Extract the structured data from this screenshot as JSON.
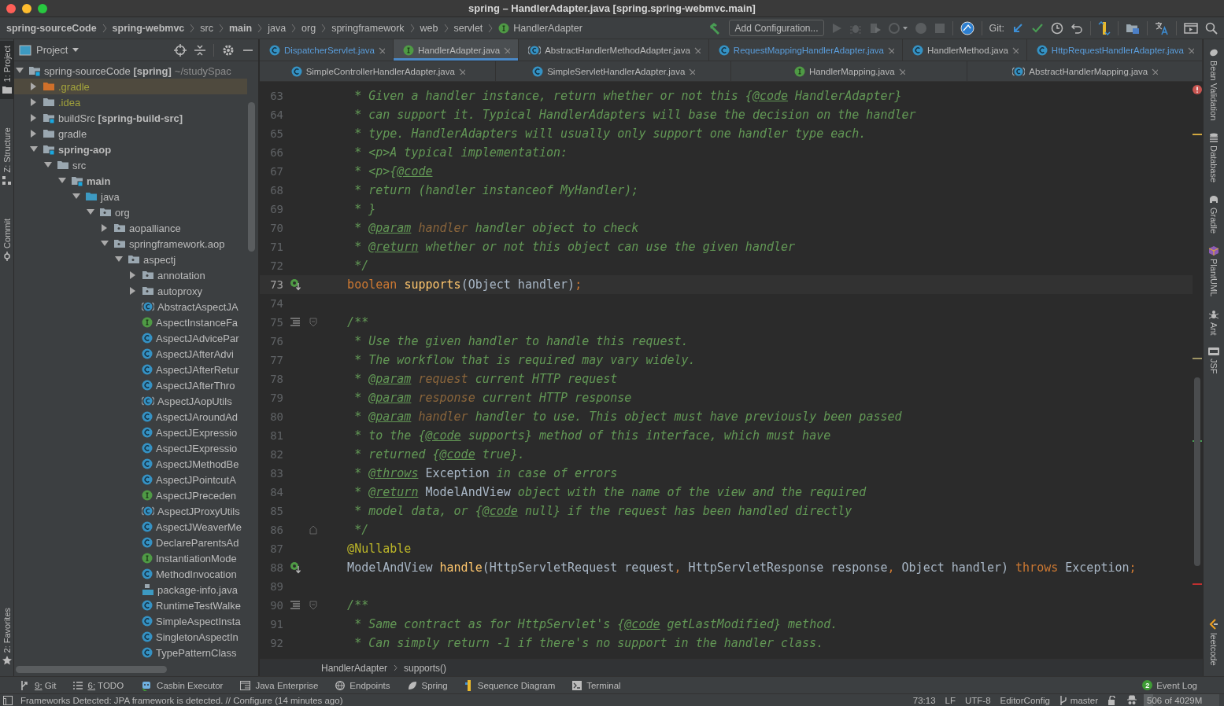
{
  "window": {
    "title": "spring – HandlerAdapter.java [spring.spring-webmvc.main]"
  },
  "navbar": {
    "breadcrumbs": [
      {
        "label": "spring-sourceCode",
        "bold": true
      },
      {
        "label": "spring-webmvc",
        "bold": true
      },
      {
        "label": "src"
      },
      {
        "label": "main",
        "bold": true
      },
      {
        "label": "java"
      },
      {
        "label": "org"
      },
      {
        "label": "springframework"
      },
      {
        "label": "web"
      },
      {
        "label": "servlet"
      },
      {
        "label": "HandlerAdapter",
        "kind": "interface"
      }
    ],
    "config_button": "Add Configuration...",
    "git_label": "Git:"
  },
  "left_tool_strip": {
    "top": [
      {
        "label": "1: Project",
        "selected": true
      },
      {
        "label": "Z: Structure",
        "selected": false
      },
      {
        "label": "Commit",
        "selected": false
      }
    ],
    "bottom": [
      {
        "label": "2: Favorites",
        "selected": false
      }
    ]
  },
  "project": {
    "title": "Project",
    "tree": [
      {
        "label": "spring-sourceCode **[spring]**",
        "suffix": "~/studySpac",
        "kind": "module",
        "expanded": true,
        "selected": false,
        "ignored": false,
        "children": [
          {
            "label": ".gradle",
            "kind": "excluded-folder",
            "expanded": false,
            "selected": true,
            "ignored": true
          },
          {
            "label": ".idea",
            "kind": "folder",
            "expanded": false,
            "selected": false,
            "ignored": true
          },
          {
            "label": "buildSrc **[spring-build-src]**",
            "kind": "module",
            "expanded": false,
            "selected": false,
            "ignored": false
          },
          {
            "label": "gradle",
            "kind": "folder",
            "expanded": false,
            "selected": false,
            "ignored": false
          },
          {
            "label": "spring-aop",
            "bold": true,
            "kind": "module",
            "expanded": true,
            "selected": false,
            "ignored": false,
            "children": [
              {
                "label": "src",
                "kind": "folder",
                "expanded": true,
                "selected": false,
                "ignored": false,
                "children": [
                  {
                    "label": "main",
                    "bold": true,
                    "kind": "module",
                    "expanded": true,
                    "selected": false,
                    "ignored": false,
                    "children": [
                      {
                        "label": "java",
                        "kind": "source-root",
                        "expanded": true,
                        "selected": false,
                        "ignored": false,
                        "children": [
                          {
                            "label": "org",
                            "kind": "package",
                            "expanded": true,
                            "selected": false,
                            "ignored": false,
                            "children": [
                              {
                                "label": "aopalliance",
                                "kind": "package",
                                "expanded": false,
                                "selected": false,
                                "ignored": false
                              },
                              {
                                "label": "springframework.aop",
                                "kind": "package",
                                "expanded": true,
                                "selected": false,
                                "ignored": false,
                                "children": [
                                  {
                                    "label": "aspectj",
                                    "kind": "package",
                                    "expanded": true,
                                    "selected": false,
                                    "ignored": false,
                                    "children": [
                                      {
                                        "label": "annotation",
                                        "kind": "package",
                                        "expanded": false,
                                        "selected": false,
                                        "ignored": false
                                      },
                                      {
                                        "label": "autoproxy",
                                        "kind": "package",
                                        "expanded": false,
                                        "selected": false,
                                        "ignored": false
                                      },
                                      {
                                        "label": "AbstractAspectJA",
                                        "kind": "abstract",
                                        "selected": false,
                                        "ignored": false
                                      },
                                      {
                                        "label": "AspectInstanceFa",
                                        "kind": "interface",
                                        "selected": false,
                                        "ignored": false
                                      },
                                      {
                                        "label": "AspectJAdvicePar",
                                        "kind": "class",
                                        "selected": false,
                                        "ignored": false
                                      },
                                      {
                                        "label": "AspectJAfterAdvi",
                                        "kind": "class",
                                        "selected": false,
                                        "ignored": false
                                      },
                                      {
                                        "label": "AspectJAfterRetur",
                                        "kind": "class",
                                        "selected": false,
                                        "ignored": false
                                      },
                                      {
                                        "label": "AspectJAfterThro",
                                        "kind": "class",
                                        "selected": false,
                                        "ignored": false
                                      },
                                      {
                                        "label": "AspectJAopUtils",
                                        "kind": "abstract",
                                        "selected": false,
                                        "ignored": false
                                      },
                                      {
                                        "label": "AspectJAroundAd",
                                        "kind": "class",
                                        "selected": false,
                                        "ignored": false
                                      },
                                      {
                                        "label": "AspectJExpressio",
                                        "kind": "class",
                                        "selected": false,
                                        "ignored": false
                                      },
                                      {
                                        "label": "AspectJExpressio",
                                        "kind": "class",
                                        "selected": false,
                                        "ignored": false
                                      },
                                      {
                                        "label": "AspectJMethodBe",
                                        "kind": "class",
                                        "selected": false,
                                        "ignored": false
                                      },
                                      {
                                        "label": "AspectJPointcutA",
                                        "kind": "class",
                                        "selected": false,
                                        "ignored": false
                                      },
                                      {
                                        "label": "AspectJPreceden",
                                        "kind": "interface",
                                        "selected": false,
                                        "ignored": false
                                      },
                                      {
                                        "label": "AspectJProxyUtils",
                                        "kind": "abstract",
                                        "selected": false,
                                        "ignored": false
                                      },
                                      {
                                        "label": "AspectJWeaverMe",
                                        "kind": "class",
                                        "selected": false,
                                        "ignored": false
                                      },
                                      {
                                        "label": "DeclareParentsAd",
                                        "kind": "class",
                                        "selected": false,
                                        "ignored": false
                                      },
                                      {
                                        "label": "InstantiationMode",
                                        "kind": "interface",
                                        "selected": false,
                                        "ignored": false
                                      },
                                      {
                                        "label": "MethodInvocation",
                                        "kind": "class",
                                        "selected": false,
                                        "ignored": false
                                      },
                                      {
                                        "label": "package-info.java",
                                        "kind": "java-file",
                                        "selected": false,
                                        "ignored": false
                                      },
                                      {
                                        "label": "RuntimeTestWalke",
                                        "kind": "class",
                                        "selected": false,
                                        "ignored": false
                                      },
                                      {
                                        "label": "SimpleAspectInsta",
                                        "kind": "class",
                                        "selected": false,
                                        "ignored": false
                                      },
                                      {
                                        "label": "SingletonAspectIn",
                                        "kind": "class",
                                        "selected": false,
                                        "ignored": false
                                      },
                                      {
                                        "label": "TypePatternClass",
                                        "kind": "class",
                                        "selected": false,
                                        "ignored": false
                                      }
                                    ]
                                  }
                                ]
                              }
                            ]
                          }
                        ]
                      }
                    ]
                  }
                ]
              }
            ]
          }
        ]
      }
    ]
  },
  "editor_tabs": [
    {
      "tabs": [
        {
          "label": "DispatcherServlet.java",
          "kind": "class",
          "modified": true,
          "selected": false
        },
        {
          "label": "HandlerAdapter.java",
          "kind": "interface",
          "modified": false,
          "selected": true
        },
        {
          "label": "AbstractHandlerMethodAdapter.java",
          "kind": "abstract",
          "modified": false,
          "selected": false
        },
        {
          "label": "RequestMappingHandlerAdapter.java",
          "kind": "class",
          "modified": true,
          "selected": false
        },
        {
          "label": "HandlerMethod.java",
          "kind": "class",
          "modified": false,
          "selected": false
        },
        {
          "label": "HttpRequestHandlerAdapter.java",
          "kind": "class",
          "modified": true,
          "selected": false
        }
      ]
    },
    {
      "tabs": [
        {
          "label": "SimpleControllerHandlerAdapter.java",
          "kind": "class",
          "modified": false,
          "selected": false
        },
        {
          "label": "SimpleServletHandlerAdapter.java",
          "kind": "class",
          "modified": false,
          "selected": false
        },
        {
          "label": "HandlerMapping.java",
          "kind": "interface",
          "modified": false,
          "selected": false
        },
        {
          "label": "AbstractHandlerMapping.java",
          "kind": "abstract",
          "modified": false,
          "selected": false
        }
      ]
    }
  ],
  "code": {
    "lines": [
      {
        "number": "63",
        "current": false,
        "spans": [
          {
            "kind": "comment",
            "text": "     * Given a handler instance, return whether or not this {"
          },
          {
            "kind": "tag",
            "text": "@code"
          },
          {
            "kind": "comment",
            "text": " HandlerAdapter}"
          }
        ]
      },
      {
        "number": "64",
        "current": false,
        "spans": [
          {
            "kind": "comment",
            "text": "     * can support it. Typical HandlerAdapters will base the decision on the handler"
          }
        ]
      },
      {
        "number": "65",
        "current": false,
        "spans": [
          {
            "kind": "comment",
            "text": "     * type. HandlerAdapters will usually only support one handler type each."
          }
        ]
      },
      {
        "number": "66",
        "current": false,
        "spans": [
          {
            "kind": "comment",
            "text": "     * <p>A typical implementation:"
          }
        ]
      },
      {
        "number": "67",
        "current": false,
        "spans": [
          {
            "kind": "comment",
            "text": "     * <p>{"
          },
          {
            "kind": "tag",
            "text": "@code"
          }
        ]
      },
      {
        "number": "68",
        "current": false,
        "spans": [
          {
            "kind": "comment",
            "text": "     * return (handler instanceof MyHandler);"
          }
        ]
      },
      {
        "number": "69",
        "current": false,
        "spans": [
          {
            "kind": "comment",
            "text": "     * }"
          }
        ]
      },
      {
        "number": "70",
        "current": false,
        "spans": [
          {
            "kind": "comment",
            "text": "     * "
          },
          {
            "kind": "tag",
            "text": "@param"
          },
          {
            "kind": "param",
            "text": " handler"
          },
          {
            "kind": "comment",
            "text": " handler object to check"
          }
        ]
      },
      {
        "number": "71",
        "current": false,
        "spans": [
          {
            "kind": "comment",
            "text": "     * "
          },
          {
            "kind": "tag",
            "text": "@return"
          },
          {
            "kind": "comment",
            "text": " whether or not this object can use the given handler"
          }
        ]
      },
      {
        "number": "72",
        "current": false,
        "spans": [
          {
            "kind": "comment",
            "text": "     */"
          }
        ]
      },
      {
        "number": "73",
        "current": true,
        "kind": "declaration",
        "spans": [
          {
            "kind": "keyword",
            "text": "    boolean "
          },
          {
            "kind": "method",
            "text": "supports"
          },
          {
            "kind": "plain",
            "text": "(Object handler)"
          },
          {
            "kind": "keyword",
            "text": ";"
          }
        ]
      },
      {
        "number": "74",
        "current": false
      },
      {
        "number": "75",
        "current": false,
        "kind": "doc-start",
        "spans": [
          {
            "kind": "comment",
            "text": "    /**"
          }
        ]
      },
      {
        "number": "76",
        "current": false,
        "spans": [
          {
            "kind": "comment",
            "text": "     * Use the given handler to handle this request."
          }
        ]
      },
      {
        "number": "77",
        "current": false,
        "spans": [
          {
            "kind": "comment",
            "text": "     * The workflow that is required may vary widely."
          }
        ]
      },
      {
        "number": "78",
        "current": false,
        "spans": [
          {
            "kind": "comment",
            "text": "     * "
          },
          {
            "kind": "tag",
            "text": "@param"
          },
          {
            "kind": "param",
            "text": " request"
          },
          {
            "kind": "comment",
            "text": " current HTTP request"
          }
        ]
      },
      {
        "number": "79",
        "current": false,
        "spans": [
          {
            "kind": "comment",
            "text": "     * "
          },
          {
            "kind": "tag",
            "text": "@param"
          },
          {
            "kind": "param",
            "text": " response"
          },
          {
            "kind": "comment",
            "text": " current HTTP response"
          }
        ]
      },
      {
        "number": "80",
        "current": false,
        "spans": [
          {
            "kind": "comment",
            "text": "     * "
          },
          {
            "kind": "tag",
            "text": "@param"
          },
          {
            "kind": "param",
            "text": " handler"
          },
          {
            "kind": "comment",
            "text": " handler to use. This object must have previously been passed"
          }
        ]
      },
      {
        "number": "81",
        "current": false,
        "spans": [
          {
            "kind": "comment",
            "text": "     * to the {"
          },
          {
            "kind": "tag",
            "text": "@code"
          },
          {
            "kind": "comment",
            "text": " supports} method of this interface, which must have"
          }
        ]
      },
      {
        "number": "82",
        "current": false,
        "spans": [
          {
            "kind": "comment",
            "text": "     * returned {"
          },
          {
            "kind": "tag",
            "text": "@code"
          },
          {
            "kind": "comment",
            "text": " true}."
          }
        ]
      },
      {
        "number": "83",
        "current": false,
        "spans": [
          {
            "kind": "comment",
            "text": "     * "
          },
          {
            "kind": "tag",
            "text": "@throws"
          },
          {
            "kind": "ref",
            "text": " Exception"
          },
          {
            "kind": "comment",
            "text": " in case of errors"
          }
        ]
      },
      {
        "number": "84",
        "current": false,
        "spans": [
          {
            "kind": "comment",
            "text": "     * "
          },
          {
            "kind": "tag",
            "text": "@return"
          },
          {
            "kind": "ref",
            "text": " ModelAndView"
          },
          {
            "kind": "comment",
            "text": " object with the name of the view and the required"
          }
        ]
      },
      {
        "number": "85",
        "current": false,
        "spans": [
          {
            "kind": "comment",
            "text": "     * model data, or {"
          },
          {
            "kind": "tag",
            "text": "@code"
          },
          {
            "kind": "comment",
            "text": " null} if the request has been handled directly"
          }
        ]
      },
      {
        "number": "86",
        "current": false,
        "kind": "doc-end",
        "spans": [
          {
            "kind": "comment",
            "text": "     */"
          }
        ]
      },
      {
        "number": "87",
        "current": false,
        "spans": [
          {
            "kind": "annotation",
            "text": "    @Nullable"
          }
        ]
      },
      {
        "number": "88",
        "current": false,
        "kind": "declaration",
        "spans": [
          {
            "kind": "plain",
            "text": "    ModelAndView "
          },
          {
            "kind": "method",
            "text": "handle"
          },
          {
            "kind": "plain",
            "text": "(HttpServletRequest request"
          },
          {
            "kind": "keyword",
            "text": ","
          },
          {
            "kind": "plain",
            "text": " HttpServletResponse response"
          },
          {
            "kind": "keyword",
            "text": ","
          },
          {
            "kind": "plain",
            "text": " Object handler) "
          },
          {
            "kind": "keyword",
            "text": "throws"
          },
          {
            "kind": "plain",
            "text": " Exception"
          },
          {
            "kind": "keyword",
            "text": ";"
          }
        ]
      },
      {
        "number": "89",
        "current": false
      },
      {
        "number": "90",
        "current": false,
        "kind": "doc-start",
        "spans": [
          {
            "kind": "comment",
            "text": "    /**"
          }
        ]
      },
      {
        "number": "91",
        "current": false,
        "spans": [
          {
            "kind": "comment",
            "text": "     * Same contract as for HttpServlet's {"
          },
          {
            "kind": "tag",
            "text": "@code"
          },
          {
            "kind": "comment",
            "text": " getLastModified} method."
          }
        ]
      },
      {
        "number": "92",
        "current": false,
        "spans": [
          {
            "kind": "comment",
            "text": "     * Can simply return -1 if there's no support in the handler class."
          }
        ]
      }
    ]
  },
  "editor_breadcrumbs": [
    "HandlerAdapter",
    "supports()"
  ],
  "right_tool_strip": {
    "top": [
      "Bean Validation",
      "Database",
      "Gradle",
      "PlantUML",
      "Ant",
      "JSF"
    ],
    "bottom": [
      "leetcode"
    ]
  },
  "tool_windows": {
    "left": [
      "9: Git",
      "6: TODO",
      "Casbin Executor",
      "Java Enterprise",
      "Endpoints",
      "Spring",
      "Sequence Diagram",
      "Terminal"
    ],
    "event_log": {
      "count": "2",
      "label": "Event Log"
    }
  },
  "status_bar": {
    "message": "Frameworks Detected: JPA framework is detected. // Configure (14 minutes ago)",
    "position": "73:13",
    "line_separator": "LF",
    "encoding": "UTF-8",
    "editor_config": "EditorConfig",
    "branch": "master",
    "memory": {
      "text": "506 of 4029M",
      "level": 0.13
    }
  }
}
